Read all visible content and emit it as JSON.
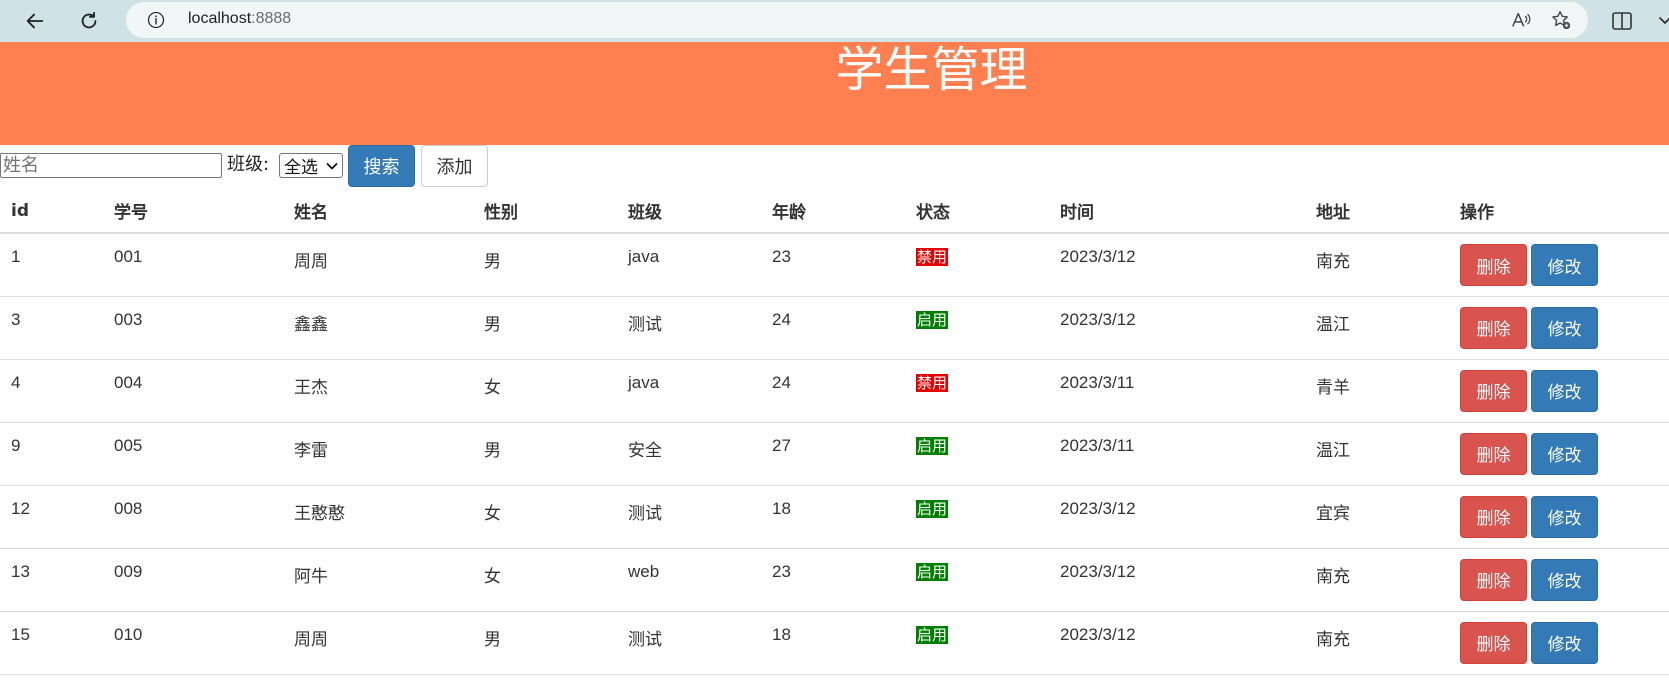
{
  "browser": {
    "url_host": "localhost",
    "url_port": ":8888"
  },
  "colors": {
    "header_bg": "#ff7f50",
    "primary": "#337ab7",
    "danger": "#d9534f",
    "status_enabled": "#008000",
    "status_disabled": "#e60000"
  },
  "header": {
    "title": "学生管理"
  },
  "toolbar": {
    "name_placeholder": "姓名",
    "class_label": "班级:",
    "class_selected": "全选",
    "search_label": "搜索",
    "add_label": "添加"
  },
  "table": {
    "columns": [
      "id",
      "学号",
      "姓名",
      "性别",
      "班级",
      "年龄",
      "状态",
      "时间",
      "地址",
      "操作"
    ],
    "delete_label": "删除",
    "edit_label": "修改",
    "rows": [
      {
        "id": "1",
        "no": "001",
        "name": "周周",
        "gender": "男",
        "class": "java",
        "age": "23",
        "status": "禁用",
        "enabled": false,
        "time": "2023/3/12",
        "addr": "南充"
      },
      {
        "id": "3",
        "no": "003",
        "name": "鑫鑫",
        "gender": "男",
        "class": "测试",
        "age": "24",
        "status": "启用",
        "enabled": true,
        "time": "2023/3/12",
        "addr": "温江"
      },
      {
        "id": "4",
        "no": "004",
        "name": "王杰",
        "gender": "女",
        "class": "java",
        "age": "24",
        "status": "禁用",
        "enabled": false,
        "time": "2023/3/11",
        "addr": "青羊"
      },
      {
        "id": "9",
        "no": "005",
        "name": "李雷",
        "gender": "男",
        "class": "安全",
        "age": "27",
        "status": "启用",
        "enabled": true,
        "time": "2023/3/11",
        "addr": "温江"
      },
      {
        "id": "12",
        "no": "008",
        "name": "王憨憨",
        "gender": "女",
        "class": "测试",
        "age": "18",
        "status": "启用",
        "enabled": true,
        "time": "2023/3/12",
        "addr": "宜宾"
      },
      {
        "id": "13",
        "no": "009",
        "name": "阿牛",
        "gender": "女",
        "class": "web",
        "age": "23",
        "status": "启用",
        "enabled": true,
        "time": "2023/3/12",
        "addr": "南充"
      },
      {
        "id": "15",
        "no": "010",
        "name": "周周",
        "gender": "男",
        "class": "测试",
        "age": "18",
        "status": "启用",
        "enabled": true,
        "time": "2023/3/12",
        "addr": "南充"
      }
    ]
  }
}
